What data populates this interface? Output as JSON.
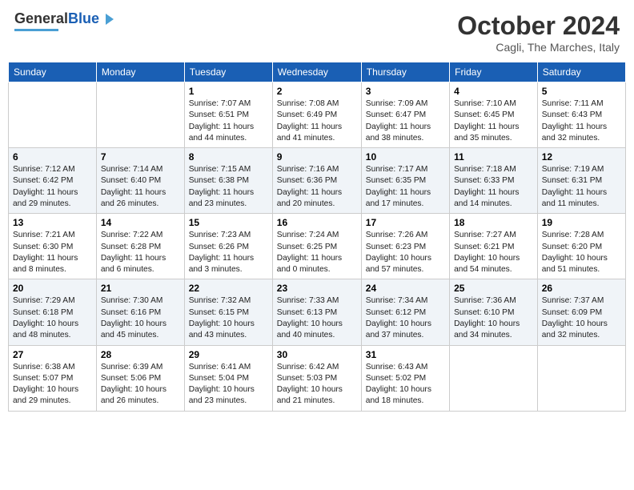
{
  "header": {
    "logo_line1": "General",
    "logo_line2": "Blue",
    "month": "October 2024",
    "location": "Cagli, The Marches, Italy"
  },
  "days_of_week": [
    "Sunday",
    "Monday",
    "Tuesday",
    "Wednesday",
    "Thursday",
    "Friday",
    "Saturday"
  ],
  "weeks": [
    [
      {
        "day": "",
        "content": ""
      },
      {
        "day": "",
        "content": ""
      },
      {
        "day": "1",
        "content": "Sunrise: 7:07 AM\nSunset: 6:51 PM\nDaylight: 11 hours\nand 44 minutes."
      },
      {
        "day": "2",
        "content": "Sunrise: 7:08 AM\nSunset: 6:49 PM\nDaylight: 11 hours\nand 41 minutes."
      },
      {
        "day": "3",
        "content": "Sunrise: 7:09 AM\nSunset: 6:47 PM\nDaylight: 11 hours\nand 38 minutes."
      },
      {
        "day": "4",
        "content": "Sunrise: 7:10 AM\nSunset: 6:45 PM\nDaylight: 11 hours\nand 35 minutes."
      },
      {
        "day": "5",
        "content": "Sunrise: 7:11 AM\nSunset: 6:43 PM\nDaylight: 11 hours\nand 32 minutes."
      }
    ],
    [
      {
        "day": "6",
        "content": "Sunrise: 7:12 AM\nSunset: 6:42 PM\nDaylight: 11 hours\nand 29 minutes."
      },
      {
        "day": "7",
        "content": "Sunrise: 7:14 AM\nSunset: 6:40 PM\nDaylight: 11 hours\nand 26 minutes."
      },
      {
        "day": "8",
        "content": "Sunrise: 7:15 AM\nSunset: 6:38 PM\nDaylight: 11 hours\nand 23 minutes."
      },
      {
        "day": "9",
        "content": "Sunrise: 7:16 AM\nSunset: 6:36 PM\nDaylight: 11 hours\nand 20 minutes."
      },
      {
        "day": "10",
        "content": "Sunrise: 7:17 AM\nSunset: 6:35 PM\nDaylight: 11 hours\nand 17 minutes."
      },
      {
        "day": "11",
        "content": "Sunrise: 7:18 AM\nSunset: 6:33 PM\nDaylight: 11 hours\nand 14 minutes."
      },
      {
        "day": "12",
        "content": "Sunrise: 7:19 AM\nSunset: 6:31 PM\nDaylight: 11 hours\nand 11 minutes."
      }
    ],
    [
      {
        "day": "13",
        "content": "Sunrise: 7:21 AM\nSunset: 6:30 PM\nDaylight: 11 hours\nand 8 minutes."
      },
      {
        "day": "14",
        "content": "Sunrise: 7:22 AM\nSunset: 6:28 PM\nDaylight: 11 hours\nand 6 minutes."
      },
      {
        "day": "15",
        "content": "Sunrise: 7:23 AM\nSunset: 6:26 PM\nDaylight: 11 hours\nand 3 minutes."
      },
      {
        "day": "16",
        "content": "Sunrise: 7:24 AM\nSunset: 6:25 PM\nDaylight: 11 hours\nand 0 minutes."
      },
      {
        "day": "17",
        "content": "Sunrise: 7:26 AM\nSunset: 6:23 PM\nDaylight: 10 hours\nand 57 minutes."
      },
      {
        "day": "18",
        "content": "Sunrise: 7:27 AM\nSunset: 6:21 PM\nDaylight: 10 hours\nand 54 minutes."
      },
      {
        "day": "19",
        "content": "Sunrise: 7:28 AM\nSunset: 6:20 PM\nDaylight: 10 hours\nand 51 minutes."
      }
    ],
    [
      {
        "day": "20",
        "content": "Sunrise: 7:29 AM\nSunset: 6:18 PM\nDaylight: 10 hours\nand 48 minutes."
      },
      {
        "day": "21",
        "content": "Sunrise: 7:30 AM\nSunset: 6:16 PM\nDaylight: 10 hours\nand 45 minutes."
      },
      {
        "day": "22",
        "content": "Sunrise: 7:32 AM\nSunset: 6:15 PM\nDaylight: 10 hours\nand 43 minutes."
      },
      {
        "day": "23",
        "content": "Sunrise: 7:33 AM\nSunset: 6:13 PM\nDaylight: 10 hours\nand 40 minutes."
      },
      {
        "day": "24",
        "content": "Sunrise: 7:34 AM\nSunset: 6:12 PM\nDaylight: 10 hours\nand 37 minutes."
      },
      {
        "day": "25",
        "content": "Sunrise: 7:36 AM\nSunset: 6:10 PM\nDaylight: 10 hours\nand 34 minutes."
      },
      {
        "day": "26",
        "content": "Sunrise: 7:37 AM\nSunset: 6:09 PM\nDaylight: 10 hours\nand 32 minutes."
      }
    ],
    [
      {
        "day": "27",
        "content": "Sunrise: 6:38 AM\nSunset: 5:07 PM\nDaylight: 10 hours\nand 29 minutes."
      },
      {
        "day": "28",
        "content": "Sunrise: 6:39 AM\nSunset: 5:06 PM\nDaylight: 10 hours\nand 26 minutes."
      },
      {
        "day": "29",
        "content": "Sunrise: 6:41 AM\nSunset: 5:04 PM\nDaylight: 10 hours\nand 23 minutes."
      },
      {
        "day": "30",
        "content": "Sunrise: 6:42 AM\nSunset: 5:03 PM\nDaylight: 10 hours\nand 21 minutes."
      },
      {
        "day": "31",
        "content": "Sunrise: 6:43 AM\nSunset: 5:02 PM\nDaylight: 10 hours\nand 18 minutes."
      },
      {
        "day": "",
        "content": ""
      },
      {
        "day": "",
        "content": ""
      }
    ]
  ]
}
